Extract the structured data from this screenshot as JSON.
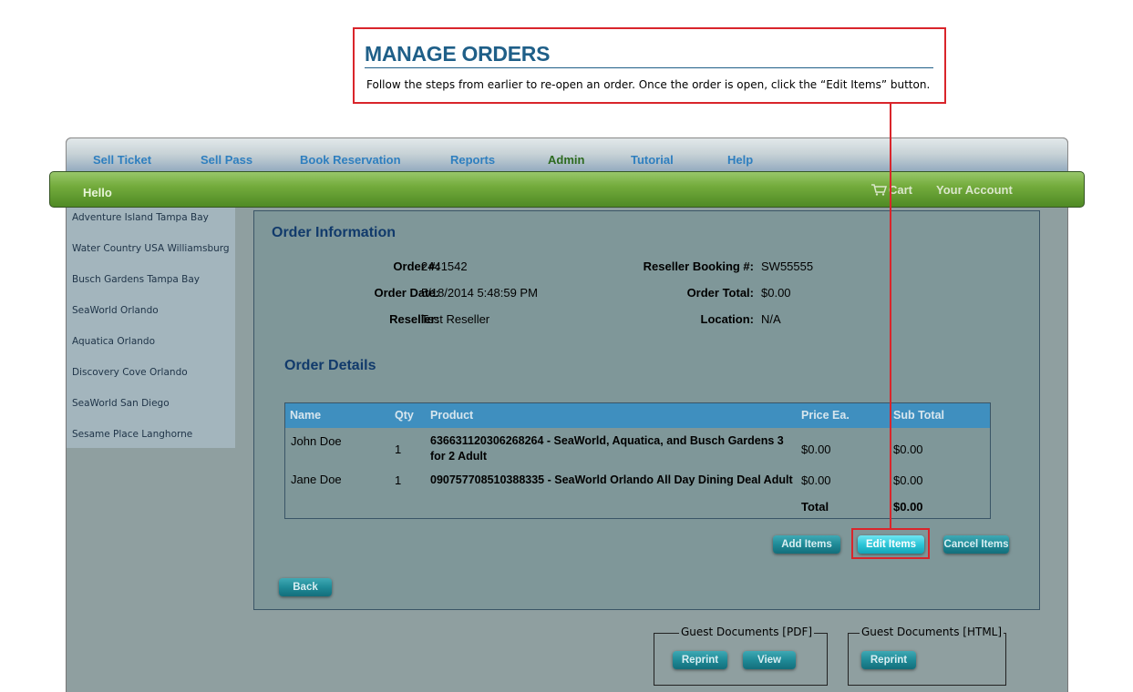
{
  "callout": {
    "title": "MANAGE ORDERS",
    "text": "Follow the steps from earlier to re-open an order. Once the order is open, click the “Edit Items” button."
  },
  "nav": {
    "items": [
      "Sell Ticket",
      "Sell Pass",
      "Book Reservation",
      "Reports",
      "Admin",
      "Tutorial",
      "Help"
    ],
    "active": "Admin"
  },
  "header": {
    "hello": "Hello",
    "cart": "Cart",
    "account": "Your Account"
  },
  "sidebar": {
    "items": [
      "Adventure Island Tampa Bay",
      "Water Country USA Williamsburg",
      "Busch Gardens Tampa Bay",
      "SeaWorld Orlando",
      "Aquatica Orlando",
      "Discovery Cove Orlando",
      "SeaWorld San Diego",
      "Sesame Place Langhorne"
    ]
  },
  "order": {
    "title": "Order Information",
    "order_num_label": "Order #:",
    "order_num": "2441542",
    "order_date_label": "Order Date:",
    "order_date": "5/18/2014 5:48:59 PM",
    "reseller_label": "Reseller:",
    "reseller": "Test Reseller",
    "booking_label": "Reseller Booking #:",
    "booking": "SW55555",
    "total_label": "Order Total:",
    "total": "$0.00",
    "location_label": "Location:",
    "location": "N/A"
  },
  "details": {
    "title": "Order Details",
    "columns": [
      "Name",
      "Qty",
      "Product",
      "Price Ea.",
      "Sub Total"
    ],
    "rows": [
      {
        "name": "John Doe",
        "qty": "1",
        "product_line1": "636631120306268264 - SeaWorld, Aquatica, and Busch Gardens 3",
        "product_line2": "for 2 Adult",
        "price": "$0.00",
        "subtotal": "$0.00"
      },
      {
        "name": "Jane Doe",
        "qty": "1",
        "product_line1": "090757708510388335 - SeaWorld Orlando All Day Dining Deal Adult",
        "price": "$0.00",
        "subtotal": "$0.00"
      }
    ],
    "total_label": "Total",
    "total_value": "$0.00"
  },
  "buttons": {
    "add_items": "Add Items",
    "edit_items": "Edit Items",
    "cancel_items": "Cancel Items",
    "back": "Back"
  },
  "documents": {
    "pdf_legend": "Guest Documents [PDF]",
    "html_legend": "Guest Documents [HTML]",
    "reprint": "Reprint",
    "view": "View"
  },
  "colors": {
    "callout_border": "#d9252b",
    "title_blue": "#1f5f88",
    "green_bar": "#74ac3d",
    "panel": "#7f9799",
    "table_header": "#3f8fbf",
    "button_teal": "#1f8a97",
    "button_highlight": "#2cc6d8"
  }
}
